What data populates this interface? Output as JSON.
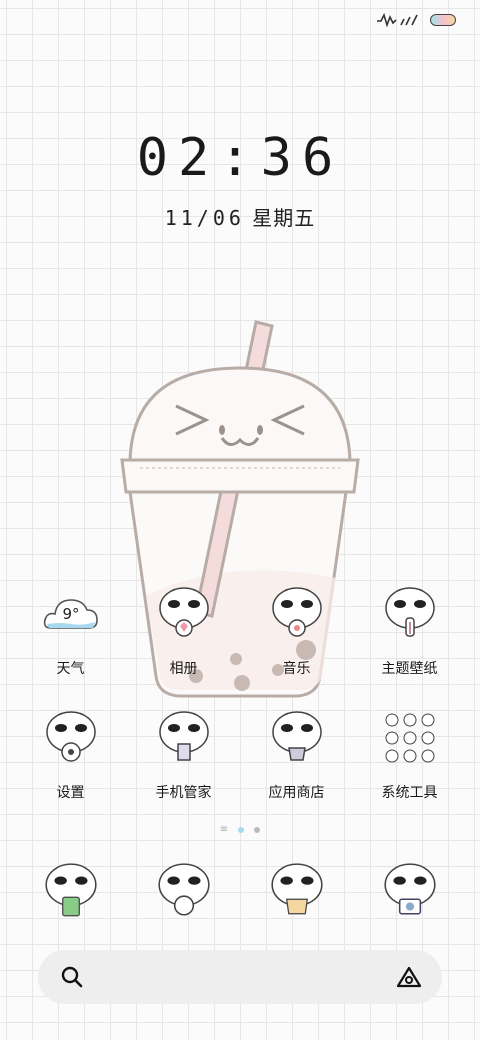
{
  "lock": {
    "time": "02:36",
    "date": "11/06",
    "weekday": "星期五"
  },
  "weather": {
    "temp": "9°"
  },
  "apps": [
    [
      {
        "label": "天气"
      },
      {
        "label": "相册"
      },
      {
        "label": "音乐"
      },
      {
        "label": "主题壁纸"
      }
    ],
    [
      {
        "label": "设置"
      },
      {
        "label": "手机管家"
      },
      {
        "label": "应用商店"
      },
      {
        "label": "系统工具"
      }
    ]
  ],
  "colors": {
    "accent": "#a8d8f0",
    "cup_outline": "#b8aca6",
    "straw": "#f4dcdc",
    "pearl": "#c9b9b3"
  },
  "icons": {
    "signal": "signal-icon",
    "battery": "battery-icon",
    "search": "search-icon",
    "assistant": "assistant-icon"
  },
  "pager": {
    "pages": 2,
    "current": 1
  }
}
